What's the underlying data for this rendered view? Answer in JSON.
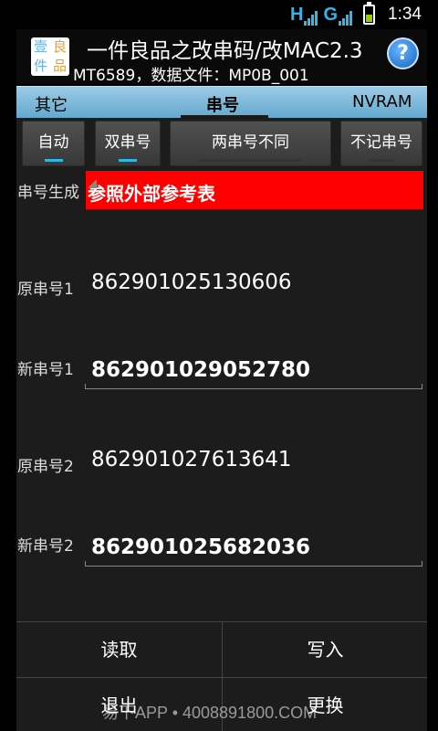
{
  "status_bar": {
    "network_type_1": "H",
    "network_type_2": "G",
    "time": "1:34"
  },
  "header": {
    "logo_chars": [
      "壹",
      "良",
      "件",
      "品"
    ],
    "title": "一件良品之改串码/改MAC2.3",
    "subtitle": "MT6589，数据文件：MP0B_001",
    "help_label": "?"
  },
  "tabs": [
    {
      "label": "其它"
    },
    {
      "label": "串号",
      "active": true
    },
    {
      "label": "NVRAM"
    }
  ],
  "mode_buttons": [
    {
      "label": "自动",
      "active": true
    },
    {
      "label": "双串号",
      "active": true
    },
    {
      "label": "两串号不同",
      "active": false
    },
    {
      "label": "不记串号",
      "active": false
    }
  ],
  "serial_gen": {
    "label": "串号生成",
    "value": "参照外部参考表",
    "color": "#ff0000"
  },
  "fields": {
    "orig1": {
      "label": "原串号1",
      "value": "862901025130606"
    },
    "new1": {
      "label": "新串号1",
      "value": "862901029052780"
    },
    "orig2": {
      "label": "原串号2",
      "value": "862901027613641"
    },
    "new2": {
      "label": "新串号2",
      "value": "862901025682036"
    }
  },
  "actions": {
    "read": "读取",
    "write": "写入",
    "exit": "退出",
    "replace": "更换"
  },
  "watermark": "易下APP • 4008891800.COM",
  "colors": {
    "accent": "#33b5e5",
    "tab_bar": "#63a9cf",
    "help": "#1565c0"
  }
}
